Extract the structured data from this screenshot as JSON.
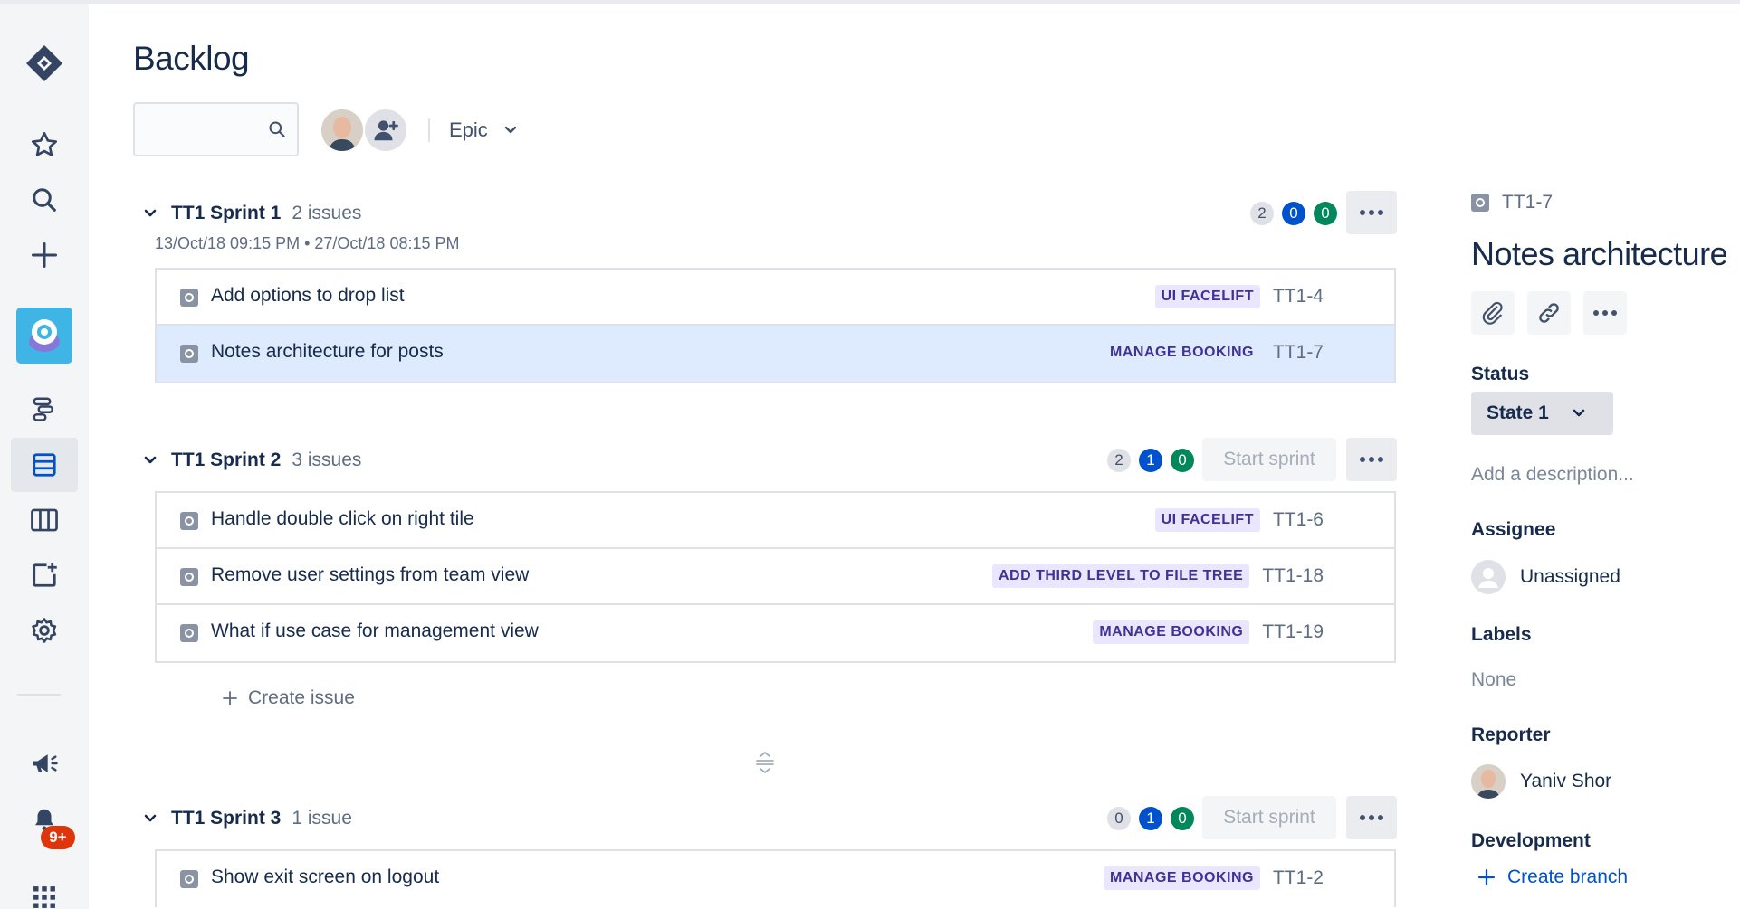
{
  "page": {
    "title": "Backlog"
  },
  "search": {
    "placeholder": ""
  },
  "filters": {
    "epic_label": "Epic"
  },
  "icons": {
    "nav": [
      "jira-logo-icon",
      "star-icon",
      "search-icon",
      "plus-icon",
      "project-avatar-icon",
      "roadmap-icon",
      "backlog-icon",
      "board-icon",
      "add-item-icon",
      "settings-icon",
      "megaphone-icon",
      "notifications-icon",
      "app-switcher-icon"
    ]
  },
  "notifications": {
    "badge": "9+"
  },
  "sprints": [
    {
      "name": "TT1 Sprint 1",
      "issue_count": "2 issues",
      "dates": "13/Oct/18 09:15 PM • 27/Oct/18 08:15 PM",
      "counts": [
        "2",
        "0",
        "0"
      ],
      "issues": [
        {
          "summary": "Add options to drop list",
          "epic": "UI FACELIFT",
          "key": "TT1-4"
        },
        {
          "summary": "Notes architecture for posts",
          "epic": "MANAGE BOOKING",
          "key": "TT1-7"
        }
      ]
    },
    {
      "name": "TT1 Sprint 2",
      "issue_count": "3 issues",
      "counts": [
        "2",
        "1",
        "0"
      ],
      "start_label": "Start sprint",
      "issues": [
        {
          "summary": "Handle double click on right tile",
          "epic": "UI FACELIFT",
          "key": "TT1-6"
        },
        {
          "summary": "Remove user settings from team view",
          "epic": "ADD THIRD LEVEL TO FILE TREE",
          "key": "TT1-18"
        },
        {
          "summary": "What if use case for management view",
          "epic": "MANAGE BOOKING",
          "key": "TT1-19"
        }
      ],
      "create_label": "Create issue"
    },
    {
      "name": "TT1 Sprint 3",
      "issue_count": "1 issue",
      "counts": [
        "0",
        "1",
        "0"
      ],
      "start_label": "Start sprint",
      "issues": [
        {
          "summary": "Show exit screen on logout",
          "epic": "MANAGE BOOKING",
          "key": "TT1-2"
        }
      ]
    }
  ],
  "detail": {
    "key": "TT1-7",
    "title": "Notes architecture",
    "status_label": "Status",
    "status_value": "State 1",
    "description_placeholder": "Add a description...",
    "assignee_label": "Assignee",
    "assignee_value": "Unassigned",
    "labels_label": "Labels",
    "labels_value": "None",
    "reporter_label": "Reporter",
    "reporter_value": "Yaniv Shor",
    "development_label": "Development",
    "create_branch_label": "Create branch"
  },
  "colors": {
    "selected_row": "#DEEBFF",
    "epic_lozenge_bg": "#EAE6FF",
    "epic_lozenge_text": "#403294",
    "count_blue": "#0052CC",
    "count_green": "#00875A",
    "badge_red": "#DE350B"
  }
}
